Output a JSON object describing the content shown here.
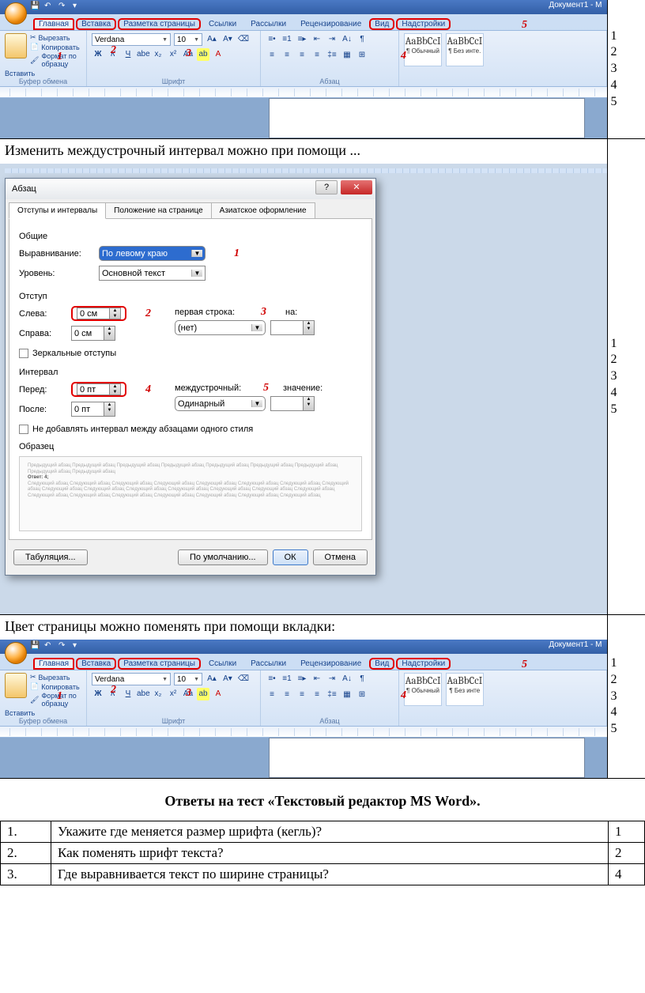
{
  "ribbon": {
    "doc_title": "Документ1 - M",
    "tabs": [
      "Главная",
      "Вставка",
      "Разметка страницы",
      "Ссылки",
      "Рассылки",
      "Рецензирование",
      "Вид",
      "Надстройки"
    ],
    "paste": "Вставить",
    "clip": {
      "cut": "Вырезать",
      "copy": "Копировать",
      "format": "Формат по образцу"
    },
    "group_clip": "Буфер обмена",
    "group_font": "Шрифт",
    "group_para": "Абзац",
    "font_name": "Verdana",
    "font_size": "10",
    "style1": "AaBbCcI",
    "style1b": "¶ Обычный",
    "style2": "AaBbCcI",
    "style2b": "¶ Без инте.",
    "style2c": "¶ Без инте"
  },
  "annot": {
    "n1": "1",
    "n2": "2",
    "n3": "3",
    "n4": "4",
    "n5": "5"
  },
  "q2_text": "Изменить междустрочный интервал можно при помощи ...",
  "q3_text": "Цвет страницы можно поменять при помощи вкладки:",
  "answers_list": {
    "l1": "1",
    "l2": "2",
    "l3": "3",
    "l4": "4",
    "l5": "5"
  },
  "dialog": {
    "title": "Абзац",
    "tabs": [
      "Отступы и интервалы",
      "Положение на странице",
      "Азиатское оформление"
    ],
    "sect_common": "Общие",
    "align_label": "Выравнивание:",
    "align_value": "По левому краю",
    "level_label": "Уровень:",
    "level_value": "Основной текст",
    "sect_indent": "Отступ",
    "left_label": "Слева:",
    "left_value": "0 см",
    "right_label": "Справа:",
    "right_value": "0 см",
    "firstline_label": "первая строка:",
    "firstline_value": "(нет)",
    "on_label": "на:",
    "mirror": "Зеркальные отступы",
    "sect_interval": "Интервал",
    "before_label": "Перед:",
    "before_value": "0 пт",
    "after_label": "После:",
    "after_value": "0 пт",
    "linesp_label": "междустрочный:",
    "linesp_value": "Одинарный",
    "value_label": "значение:",
    "nosame": "Не добавлять интервал между абзацами одного стиля",
    "sect_sample": "Образец",
    "btn_tab": "Табуляция...",
    "btn_default": "По умолчанию...",
    "btn_ok": "ОК",
    "btn_cancel": "Отмена"
  },
  "answers_title": "Ответы на тест «Текстовый редактор MS Word».",
  "ans_table": [
    {
      "n": "1.",
      "q": "Укажите где меняется размер шрифта (кегль)?",
      "a": "1"
    },
    {
      "n": "2.",
      "q": "Как поменять шрифт текста?",
      "a": "2"
    },
    {
      "n": "3.",
      "q": "Где выравнивается текст по ширине страницы?",
      "a": "4"
    }
  ]
}
